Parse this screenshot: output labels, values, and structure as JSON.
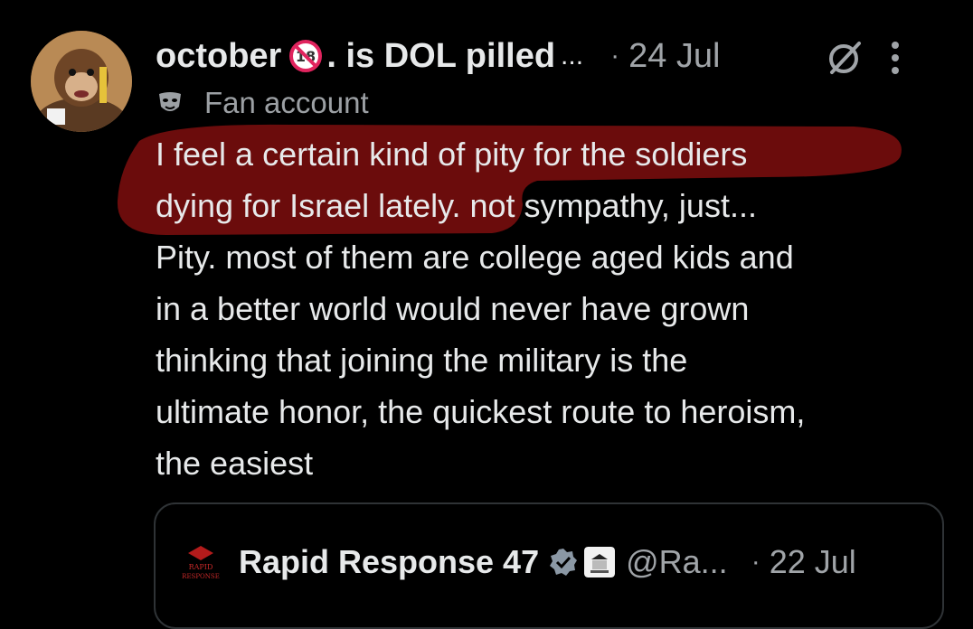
{
  "post": {
    "display_name": "october",
    "age_badge": "18",
    "name_suffix": ". is DOL pilled",
    "name_ellipsis": "...",
    "separator": "·",
    "date": "24 Jul",
    "account_label": "Fan account",
    "text": "I feel a certain kind of pity for the soldiers\ndying for Israel lately. not sympathy, just...\nPity. most of them are college aged kids and\nin a better world would never have grown\nthinking that joining the military is the\nultimate honor, the quickest route to heroism,\nthe easiest",
    "highlight_color": "#6b0c0c",
    "icons": [
      "grok-icon",
      "more-icon",
      "mask-icon",
      "age-18-badge-icon"
    ]
  },
  "quote": {
    "avatar_text": "RAPID RESPONSE",
    "display_name": "Rapid Response 47",
    "handle": "@Ra...",
    "separator": "·",
    "date": "22 Jul",
    "icons": [
      "verified-icon",
      "white-house-badge-icon"
    ]
  },
  "colors": {
    "background": "#000000",
    "text": "#e7e9ea",
    "muted": "#a0a4a8",
    "verified": "#1d9bf0",
    "age_badge": "#e0245e"
  }
}
